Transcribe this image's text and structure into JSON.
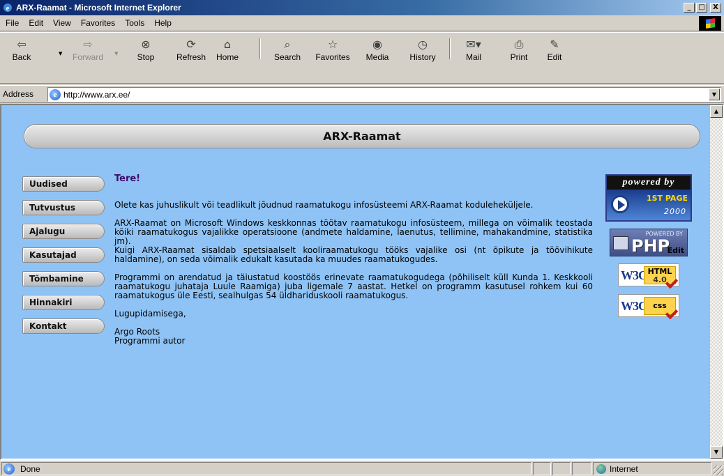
{
  "window": {
    "title": "ARX-Raamat - Microsoft Internet Explorer",
    "controls": {
      "minimize": "_",
      "maximize": "□",
      "close": "X"
    }
  },
  "menu": [
    "File",
    "Edit",
    "View",
    "Favorites",
    "Tools",
    "Help"
  ],
  "toolbar": {
    "back": "Back",
    "forward": "Forward",
    "stop": "Stop",
    "refresh": "Refresh",
    "home": "Home",
    "search": "Search",
    "favorites": "Favorites",
    "media": "Media",
    "history": "History",
    "mail": "Mail",
    "print": "Print",
    "edit": "Edit"
  },
  "address": {
    "label": "Address",
    "url": "http://www.arx.ee/"
  },
  "page": {
    "banner_title": "ARX-Raamat",
    "nav": [
      "Uudised",
      "Tutvustus",
      "Ajalugu",
      "Kasutajad",
      "Tõmbamine",
      "Hinnakiri",
      "Kontakt"
    ],
    "greeting": "Tere!",
    "paragraphs": [
      "Olete kas juhuslikult või teadlikult jõudnud raamatukogu infosüsteemi ARX-Raamat koduleheküljele.",
      "ARX-Raamat on Microsoft Windows keskkonnas töötav raamatukogu infosüsteem, millega on võimalik teostada kõiki raamatukogus vajalikke operatsioone (andmete haldamine, laenutus, tellimine, mahakandmine, statistika jm).",
      "Kuigi ARX-Raamat sisaldab spetsiaalselt kooliraamatukogu tööks vajalike osi (nt õpikute ja töövihikute haldamine), on seda võimalik edukalt kasutada ka muudes raamatukogudes.",
      "Programmi on arendatud ja täiustatud koostöös erinevate raamatukogudega (põhiliselt küll Kunda 1. Keskkooli raamatukogu juhataja Luule Raamiga) juba ligemale 7 aastat. Hetkel on programm kasutusel rohkem kui 60 raamatukogus üle Eesti, sealhulgas 54 üldhariduskooli raamatukogus.",
      "Lugupidamisega,"
    ],
    "signature_name": "Argo Roots",
    "signature_role": "Programmi autor",
    "badges": {
      "firstpage_top": "powered by",
      "firstpage_name": "1ST PAGE",
      "firstpage_year": "2000",
      "php_top": "POWERED BY",
      "php_name": "PHP",
      "php_edit": "Edit",
      "w3c": "W3C",
      "html_name": "HTML",
      "html_version": "4.0",
      "css_name": "css"
    }
  },
  "status": {
    "text": "Done",
    "zone": "Internet"
  }
}
